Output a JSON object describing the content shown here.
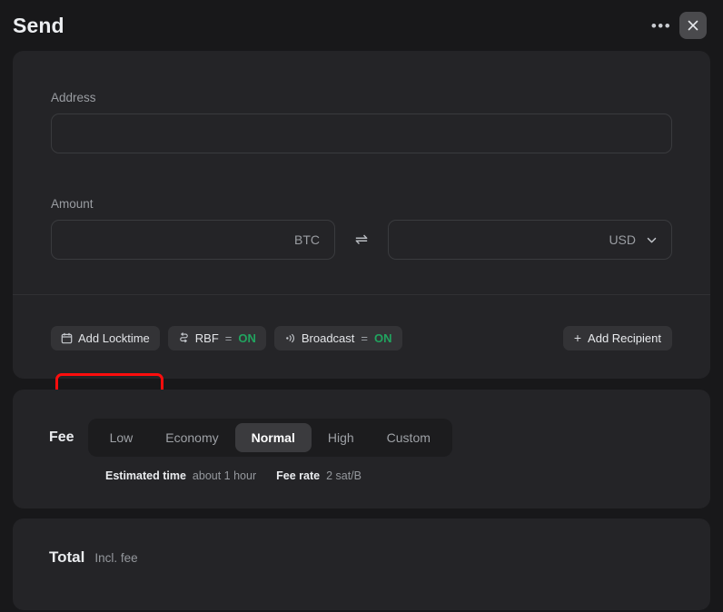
{
  "header": {
    "title": "Send",
    "more_label": "•••",
    "close_icon": "close-icon"
  },
  "form": {
    "address": {
      "label": "Address",
      "value": "",
      "placeholder": ""
    },
    "amount": {
      "label": "Amount",
      "crypto_value": "",
      "crypto_unit": "BTC",
      "swap_icon": "⇌",
      "fiat_value": "",
      "fiat_unit": "USD",
      "fiat_unit_options": [
        "USD"
      ]
    },
    "options": [
      {
        "name": "add-locktime",
        "icon": "calendar-icon",
        "label": "Add Locktime",
        "has_value": false,
        "highlighted": true
      },
      {
        "name": "rbf",
        "icon": "swap-vertical-icon",
        "label": "RBF",
        "separator": "=",
        "value": "ON",
        "has_value": true,
        "highlighted": false
      },
      {
        "name": "broadcast",
        "icon": "broadcast-icon",
        "label": "Broadcast",
        "separator": "=",
        "value": "ON",
        "has_value": true,
        "highlighted": false
      }
    ],
    "add_recipient": {
      "icon": "plus-icon",
      "label": "Add Recipient"
    }
  },
  "fee": {
    "label": "Fee",
    "options": [
      "Low",
      "Economy",
      "Normal",
      "High",
      "Custom"
    ],
    "selected": "Normal",
    "meta": {
      "estimated_time_key": "Estimated time",
      "estimated_time_value": "about 1 hour",
      "fee_rate_key": "Fee rate",
      "fee_rate_value": "2 sat/B"
    }
  },
  "total": {
    "label": "Total",
    "sublabel": "Incl. fee",
    "value": ""
  },
  "colors": {
    "page_background": "#18181a",
    "card_background": "#242427",
    "chip_background": "#333336",
    "segmented_background": "#1c1c1e",
    "segment_active": "#3b3b3e",
    "accent_on": "#21a45f",
    "annotation_red": "#fd0d0d",
    "text_primary": "#eaecef",
    "text_muted": "#95989d",
    "border": "#3a3b3e"
  }
}
